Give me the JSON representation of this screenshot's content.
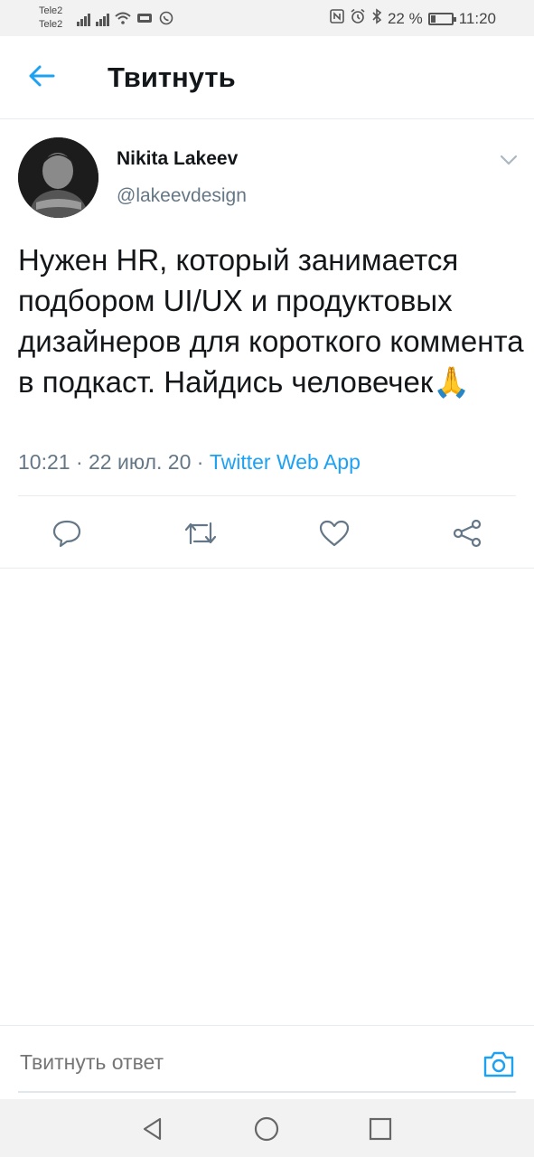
{
  "status_bar": {
    "carrier1": "Tele2",
    "carrier2": "Tele2",
    "battery_text": "22 %",
    "battery_level": 0.22,
    "time": "11:20"
  },
  "header": {
    "title": "Твитнуть"
  },
  "tweet": {
    "author_name": "Nikita Lakeev",
    "author_handle": "@lakeevdesign",
    "text": "Нужен HR, который занимается подбором UI/UX и продуктовых дизайнеров для короткого коммента в подкаст. Найдись человечек🙏",
    "time": "10:21",
    "date": "22 июл. 20",
    "separator": " · ",
    "source": "Twitter Web App"
  },
  "reply": {
    "placeholder": "Твитнуть ответ"
  },
  "colors": {
    "accent": "#1da1f2",
    "text_primary": "#14171a",
    "text_secondary": "#657786",
    "divider": "#e6ecf0"
  },
  "icons": {
    "back": "arrow-left-icon",
    "caret": "chevron-down-icon",
    "reply": "speech-bubble-icon",
    "retweet": "retweet-icon",
    "like": "heart-icon",
    "share": "share-icon",
    "camera": "camera-icon",
    "nav_back": "triangle-back-icon",
    "nav_home": "circle-home-icon",
    "nav_recents": "square-recents-icon"
  }
}
